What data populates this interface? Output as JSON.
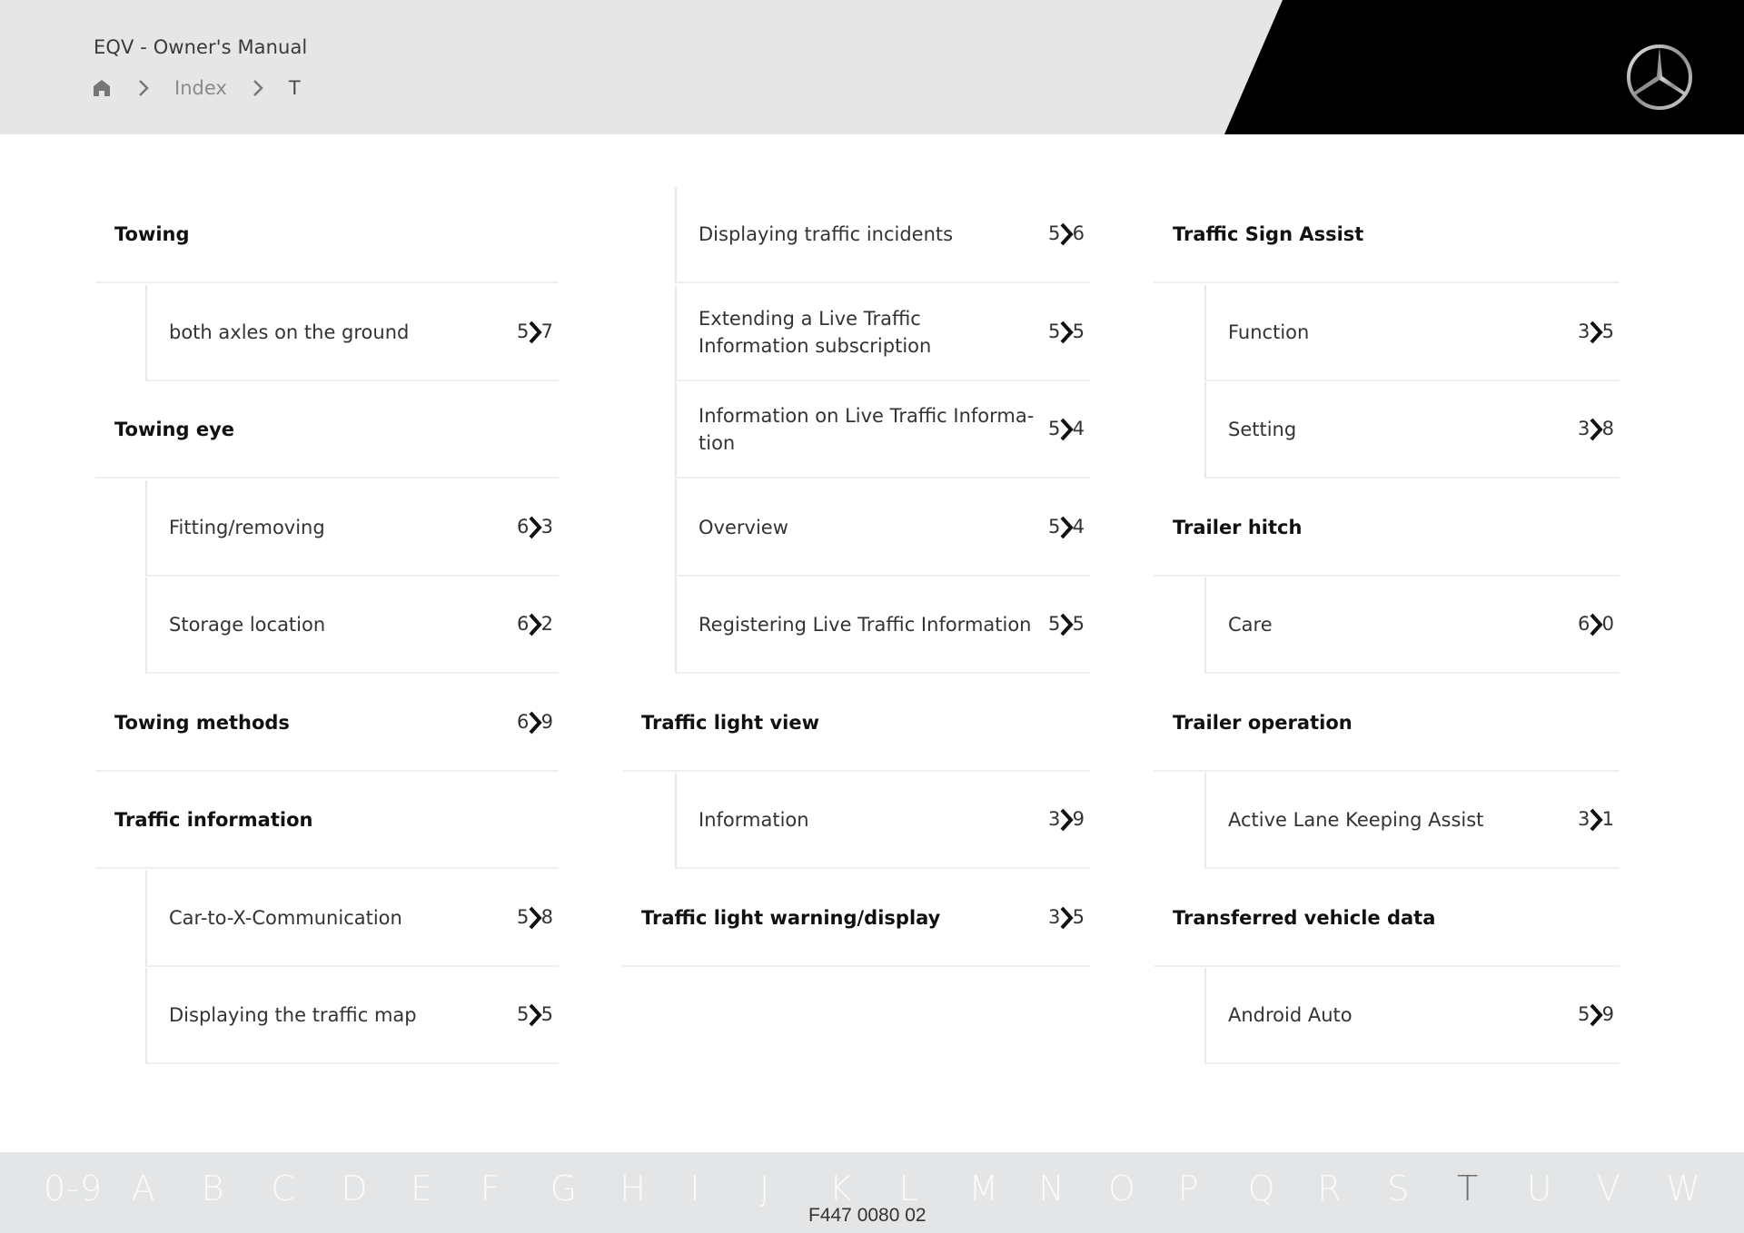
{
  "header": {
    "app_title": "EQV - Owner's Manual",
    "breadcrumb": {
      "home_icon": "home-icon",
      "separator_icon": "chevron-right-icon",
      "items": [
        "Index",
        "T"
      ]
    },
    "logo": "mercedes-star-logo",
    "colors": {
      "bar": "#e6e6e6",
      "accent_block": "#000000"
    }
  },
  "index": {
    "columns": [
      {
        "entries": [
          {
            "type": "head",
            "label": "Towing",
            "page": null
          },
          {
            "type": "sub",
            "label": "both axles on the ground",
            "page": [
              "5",
              "7"
            ]
          },
          {
            "type": "head",
            "label": "Towing eye",
            "page": null
          },
          {
            "type": "sub",
            "label": "Fitting/removing",
            "page": [
              "6",
              "3"
            ]
          },
          {
            "type": "sub",
            "label": "Storage location",
            "page": [
              "6",
              "2"
            ]
          },
          {
            "type": "head",
            "label": "Towing methods",
            "page": [
              "6",
              "9"
            ]
          },
          {
            "type": "head",
            "label": "Traffic information",
            "page": null
          },
          {
            "type": "sub",
            "label": "Car-to-X-Communication",
            "page": [
              "5",
              "8"
            ]
          },
          {
            "type": "sub",
            "label": "Displaying the traffic map",
            "page": [
              "5",
              "5"
            ]
          }
        ]
      },
      {
        "entries": [
          {
            "type": "sub",
            "label": "Displaying traffic incidents",
            "page": [
              "5",
              "6"
            ]
          },
          {
            "type": "sub",
            "label": "Extending a Live Traffic Information subscription",
            "page": [
              "5",
              "5"
            ]
          },
          {
            "type": "sub",
            "label": "Information on Live Traffic Informa-tion",
            "page": [
              "5",
              "4"
            ]
          },
          {
            "type": "sub",
            "label": "Overview",
            "page": [
              "5",
              "4"
            ]
          },
          {
            "type": "sub",
            "label": "Registering Live Traffic Information",
            "page": [
              "5",
              "5"
            ]
          },
          {
            "type": "head",
            "label": "Traffic light view",
            "page": null
          },
          {
            "type": "sub",
            "label": "Information",
            "page": [
              "3",
              "9"
            ]
          },
          {
            "type": "head",
            "label": "Traffic light warning/display",
            "page": [
              "3",
              "5"
            ]
          }
        ]
      },
      {
        "entries": [
          {
            "type": "head",
            "label": "Traffic Sign Assist",
            "page": null
          },
          {
            "type": "sub",
            "label": "Function",
            "page": [
              "3",
              "5"
            ]
          },
          {
            "type": "sub",
            "label": "Setting",
            "page": [
              "3",
              "8"
            ]
          },
          {
            "type": "head",
            "label": "Trailer hitch",
            "page": null
          },
          {
            "type": "sub",
            "label": "Care",
            "page": [
              "6",
              "0"
            ]
          },
          {
            "type": "head",
            "label": "Trailer operation",
            "page": null
          },
          {
            "type": "sub",
            "label": "Active Lane Keeping Assist",
            "page": [
              "3",
              "1"
            ]
          },
          {
            "type": "head",
            "label": "Transferred vehicle data",
            "page": null
          },
          {
            "type": "sub",
            "label": "Android Auto",
            "page": [
              "5",
              "9"
            ]
          }
        ]
      }
    ],
    "page_link_icon": "chevron-right-icon"
  },
  "footer": {
    "alphabet": [
      "0-9",
      "A",
      "B",
      "C",
      "D",
      "E",
      "F",
      "G",
      "H",
      "I",
      "J",
      "K",
      "L",
      "M",
      "N",
      "O",
      "P",
      "Q",
      "R",
      "S",
      "T",
      "U",
      "V",
      "W"
    ],
    "active_letter": "T",
    "doc_code": "F447 0080 02"
  }
}
